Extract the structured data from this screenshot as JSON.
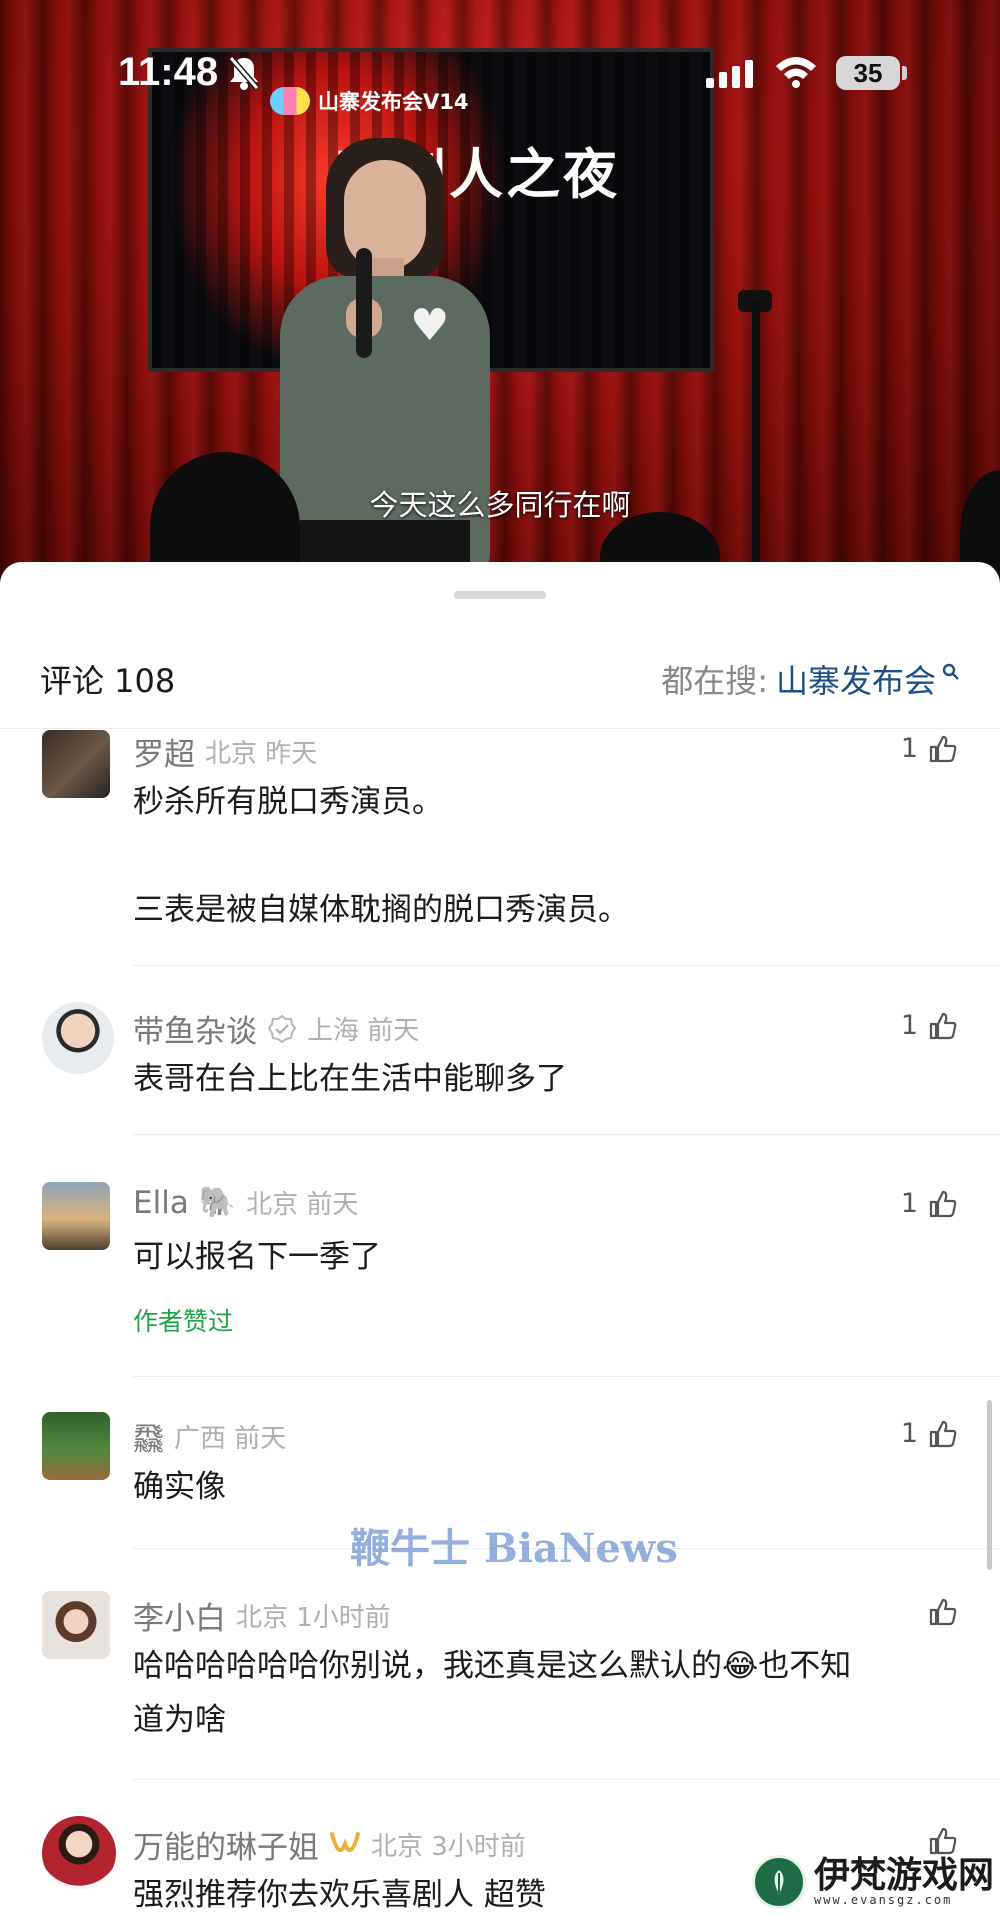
{
  "status_bar": {
    "time": "11:48",
    "battery": "35"
  },
  "video": {
    "event_logo": "山寨发布会V14",
    "event_title": "喜剧人之夜",
    "subtitle": "今天这么多同行在啊"
  },
  "sheet": {
    "comment_count": "评论 108",
    "search_prefix": "都在搜:",
    "search_term": "山寨发布会"
  },
  "comments": [
    {
      "name": "罗超",
      "meta": "北京 昨天",
      "text_lines": [
        "秒杀所有脱口秀演员。",
        "",
        "三表是被自媒体耽搁的脱口秀演员。"
      ],
      "likes": "1"
    },
    {
      "name": "带鱼杂谈",
      "meta": "上海 前天",
      "text_lines": [
        "表哥在台上比在生活中能聊多了"
      ],
      "likes": "1",
      "verified": true
    },
    {
      "name": "Ella",
      "emoji": "🐘",
      "meta": "北京 前天",
      "text_lines": [
        "可以报名下一季了"
      ],
      "likes": "1",
      "author_liked": "作者赞过"
    },
    {
      "name": "飝",
      "meta": "广西 前天",
      "text_lines": [
        "确实像"
      ],
      "likes": "1"
    },
    {
      "name": "李小白",
      "meta": "北京 1小时前",
      "text_lines": [
        "哈哈哈哈哈哈你别说，我还真是这么默认的😂也不知",
        "道为啥"
      ],
      "likes": ""
    },
    {
      "name": "万能的琳子姐",
      "meta": "北京 3小时前",
      "text_lines": [
        "强烈推荐你去欢乐喜剧人 超赞"
      ],
      "likes": ""
    }
  ],
  "watermark": "鞭牛士 BiaNews",
  "site_logo": {
    "name": "伊梵游戏网",
    "url": "www.evansgz.com"
  },
  "colors": {
    "search_term": "#1c4f86",
    "author_liked": "#21a34a",
    "sheet_bg": "#ffffff"
  }
}
